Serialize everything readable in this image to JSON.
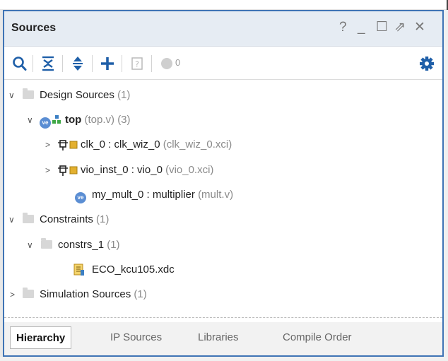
{
  "panel": {
    "title": "Sources",
    "controls": [
      "?",
      "_",
      "☐",
      "⇗",
      "✕"
    ]
  },
  "toolbar": {
    "count": "0",
    "icons": [
      "search-icon",
      "collapse-all-icon",
      "expand-all-icon",
      "add-icon",
      "help-icon",
      "status-circle-icon",
      "gear-icon"
    ]
  },
  "tree": {
    "design_sources": {
      "label": "Design Sources",
      "count": "(1)"
    },
    "top": {
      "label": "top",
      "file": "(top.v)",
      "count": "(3)"
    },
    "clk": {
      "label": "clk_0 : clk_wiz_0",
      "file": "(clk_wiz_0.xci)"
    },
    "vio": {
      "label": "vio_inst_0 : vio_0",
      "file": "(vio_0.xci)"
    },
    "mult": {
      "label": "my_mult_0 : multiplier",
      "file": "(mult.v)"
    },
    "constraints": {
      "label": "Constraints",
      "count": "(1)"
    },
    "constrs": {
      "label": "constrs_1",
      "count": "(1)"
    },
    "xdc": {
      "label": "ECO_kcu105.xdc"
    },
    "simulation": {
      "label": "Simulation Sources",
      "count": "(1)"
    }
  },
  "tabs": [
    {
      "label": "Hierarchy",
      "active": true
    },
    {
      "label": "IP Sources"
    },
    {
      "label": "Libraries"
    },
    {
      "label": "Compile Order"
    }
  ],
  "colors": {
    "accent": "#3f74b5",
    "icon_blue": "#3c7fc4",
    "ip_gold": "#e3b02f",
    "ve_blue": "#5b8ed3"
  }
}
